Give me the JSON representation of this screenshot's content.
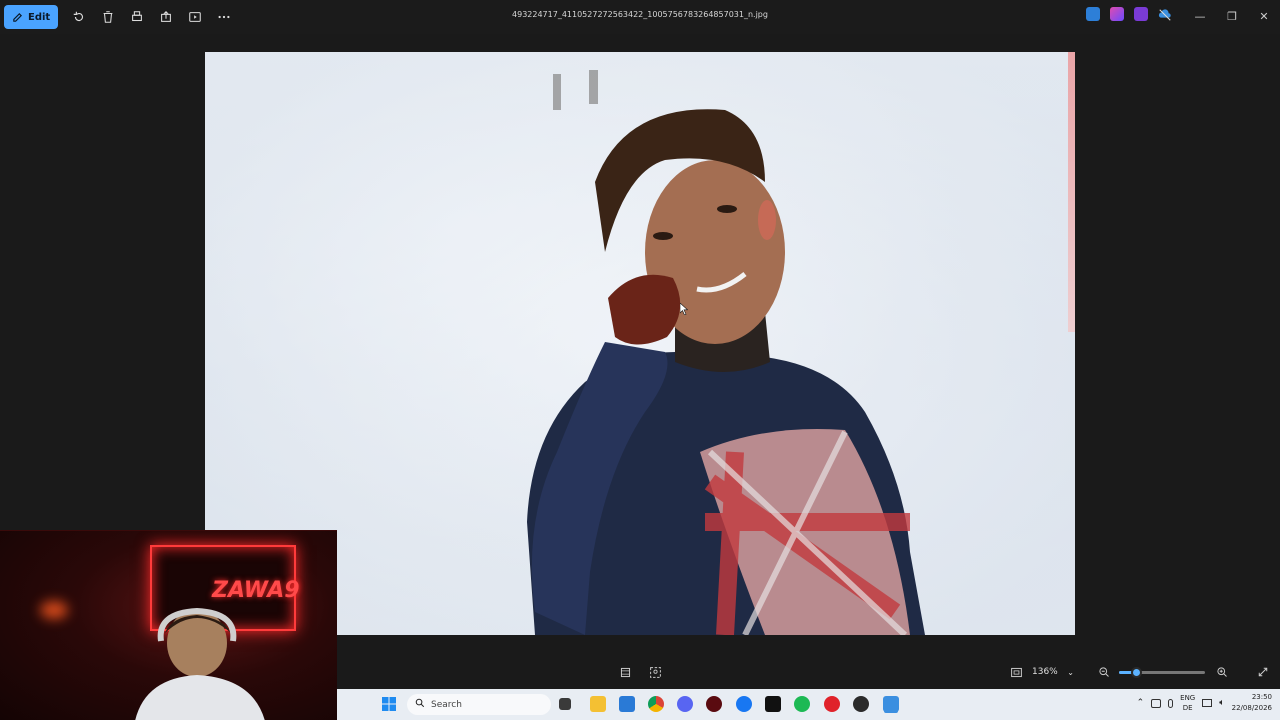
{
  "toolbar": {
    "edit_label": "Edit",
    "filename": "493224717_4110527272563422_1005756783264857031_n.jpg"
  },
  "bottombar": {
    "zoom_level": "136%",
    "zoom_slider_fraction": 0.2
  },
  "taskbar": {
    "search_placeholder": "Search",
    "language": "ENG",
    "region": "DE",
    "time": "23:50",
    "date": "22/08/2026"
  },
  "webcam": {
    "neon_sign": "ZAWA9"
  },
  "colors": {
    "accent": "#4aa3ff",
    "webcam_neon": "#ff3b3b"
  }
}
